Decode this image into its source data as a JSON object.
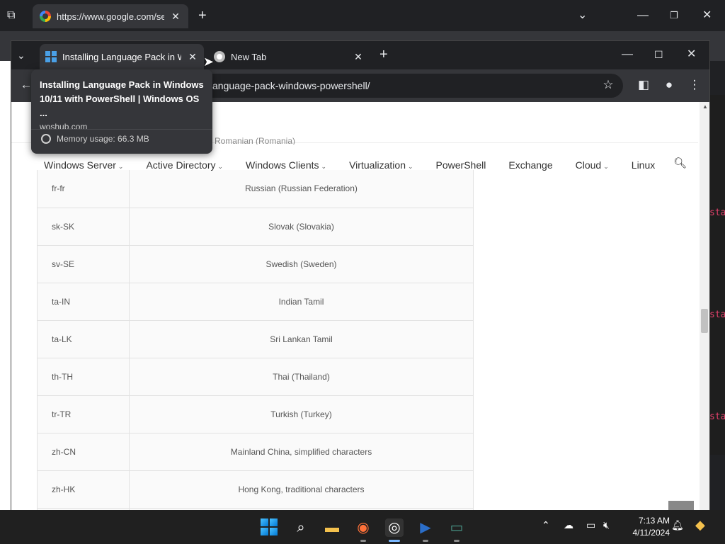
{
  "background_window": {
    "tab_title": "https://www.google.com/search",
    "terminal_fragments": [
      "sta",
      "sta",
      "sta"
    ]
  },
  "tabs": [
    {
      "title": "Installing Language Pack in Windows",
      "icon": "windows-logo-icon"
    },
    {
      "title": "New Tab",
      "icon": "chrome-icon"
    }
  ],
  "address_bar": {
    "url": "anguage-pack-windows-powershell/"
  },
  "tooltip": {
    "title": "Installing Language Pack in Windows 10/11 with PowerShell | Windows OS ...",
    "domain": "woshub.com",
    "memory": "Memory usage: 66.3 MB"
  },
  "partial_row": "Romanian (Romania)",
  "nav": [
    {
      "label": "Windows Server",
      "dropdown": true
    },
    {
      "label": "Active Directory",
      "dropdown": true
    },
    {
      "label": "Windows Clients",
      "dropdown": true
    },
    {
      "label": "Virtualization",
      "dropdown": true
    },
    {
      "label": "PowerShell",
      "dropdown": false
    },
    {
      "label": "Exchange",
      "dropdown": false
    },
    {
      "label": "Cloud",
      "dropdown": true
    },
    {
      "label": "Linux",
      "dropdown": false
    }
  ],
  "languages": [
    {
      "code": "fr-fr",
      "name": "Russian (Russian Federation)"
    },
    {
      "code": "sk-SK",
      "name": "Slovak (Slovakia)"
    },
    {
      "code": "sv-SE",
      "name": "Swedish (Sweden)"
    },
    {
      "code": "ta-IN",
      "name": "Indian Tamil"
    },
    {
      "code": "ta-LK",
      "name": "Sri Lankan Tamil"
    },
    {
      "code": "th-TH",
      "name": "Thai (Thailand)"
    },
    {
      "code": "tr-TR",
      "name": "Turkish (Turkey)"
    },
    {
      "code": "zh-CN",
      "name": "Mainland China, simplified characters"
    },
    {
      "code": "zh-HK",
      "name": "Hong Kong, traditional characters"
    },
    {
      "code": "",
      "name": ""
    }
  ],
  "clock": {
    "time": "7:13 AM",
    "date": "4/11/2024"
  }
}
